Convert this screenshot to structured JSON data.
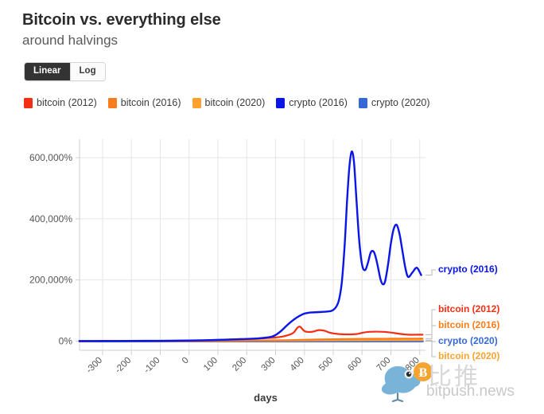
{
  "header": {
    "title": "Bitcoin vs. everything else",
    "subtitle": "around halvings"
  },
  "scale_toggle": {
    "options": [
      {
        "label": "Linear",
        "active": true
      },
      {
        "label": "Log",
        "active": false
      }
    ]
  },
  "watermark": {
    "cn_text": "比推",
    "domain": "bitpush.news",
    "bird_icon": "bird-icon",
    "coin_icon": "bitcoin-coin-icon",
    "coin_symbol": "Ƀ"
  },
  "colors": {
    "bitcoin_2012": "#f42e14",
    "bitcoin_2016": "#f97c1c",
    "bitcoin_2020": "#fba22e",
    "crypto_2016": "#0a16e8",
    "crypto_2020": "#3769d6",
    "grid": "#e6e6e6",
    "axis": "#cfcfcf",
    "text": "#555555",
    "toggle_active_bg": "#333333"
  },
  "chart_data": {
    "type": "line",
    "title": "Bitcoin vs. everything else",
    "subtitle": "around halvings",
    "xlabel": "days",
    "ylabel": "",
    "scale": "linear",
    "grid": true,
    "legend_position": "top",
    "xlim": [
      -380,
      820
    ],
    "ylim": [
      -30000,
      660000
    ],
    "xticks": [
      -300,
      -200,
      -100,
      0,
      100,
      200,
      300,
      400,
      500,
      600,
      700,
      800
    ],
    "xtick_labels": [
      "-300",
      "-200",
      "-100",
      "0",
      "100",
      "200",
      "300",
      "400",
      "500",
      "600",
      "700",
      "800"
    ],
    "yticks": [
      0,
      200000,
      400000,
      600000
    ],
    "ytick_labels": [
      "0%",
      "200,000%",
      "400,000%",
      "600,000%"
    ],
    "series": [
      {
        "name": "bitcoin (2012)",
        "color": "#f42e14",
        "end_label": "bitcoin (2012)",
        "x": [
          -380,
          -300,
          -200,
          -100,
          0,
          50,
          100,
          150,
          200,
          250,
          300,
          330,
          360,
          375,
          385,
          400,
          415,
          430,
          450,
          470,
          490,
          520,
          550,
          580,
          600,
          620,
          650,
          680,
          700,
          730,
          760,
          790,
          810
        ],
        "y": [
          0,
          200,
          500,
          900,
          1500,
          2500,
          4000,
          5500,
          7000,
          9000,
          12000,
          16000,
          26000,
          43000,
          47000,
          33000,
          30000,
          31000,
          36000,
          34000,
          27000,
          23000,
          22000,
          23000,
          27000,
          30000,
          31000,
          30000,
          28000,
          24000,
          21000,
          21000,
          21000
        ]
      },
      {
        "name": "bitcoin (2016)",
        "color": "#f97c1c",
        "end_label": "bitcoin (2016)",
        "x": [
          -380,
          -300,
          -200,
          -100,
          0,
          100,
          200,
          300,
          350,
          400,
          450,
          500,
          550,
          600,
          650,
          700,
          750,
          810
        ],
        "y": [
          0,
          80,
          150,
          250,
          400,
          900,
          1500,
          2500,
          3400,
          4500,
          5400,
          6200,
          7000,
          7500,
          7800,
          8000,
          8200,
          8400
        ]
      },
      {
        "name": "bitcoin (2020)",
        "color": "#fba22e",
        "end_label": "bitcoin (2020)",
        "x": [
          -380,
          -300,
          -200,
          -100,
          0,
          100,
          200,
          300,
          400,
          500,
          600,
          700,
          810
        ],
        "y": [
          0,
          50,
          90,
          150,
          250,
          500,
          800,
          1300,
          1900,
          2300,
          2600,
          2800,
          3000
        ]
      },
      {
        "name": "crypto (2016)",
        "color": "#0a16e8",
        "end_label": "crypto (2016)",
        "x": [
          -380,
          -300,
          -200,
          -100,
          0,
          60,
          120,
          180,
          240,
          280,
          300,
          320,
          340,
          360,
          375,
          390,
          400,
          415,
          430,
          450,
          470,
          490,
          500,
          510,
          520,
          530,
          540,
          548,
          556,
          564,
          572,
          580,
          590,
          600,
          610,
          620,
          630,
          640,
          648,
          656,
          664,
          672,
          680,
          690,
          700,
          710,
          720,
          730,
          740,
          750,
          760,
          775,
          790,
          805
        ],
        "y": [
          0,
          300,
          700,
          1200,
          2000,
          3000,
          4500,
          6500,
          9000,
          13000,
          20000,
          34000,
          52000,
          68000,
          78000,
          86000,
          90000,
          93000,
          94000,
          95000,
          96000,
          98000,
          102000,
          112000,
          135000,
          195000,
          320000,
          460000,
          570000,
          620000,
          585000,
          470000,
          330000,
          250000,
          232000,
          255000,
          290000,
          293000,
          272000,
          238000,
          202000,
          186000,
          196000,
          250000,
          320000,
          368000,
          380000,
          350000,
          295000,
          240000,
          210000,
          225000,
          240000,
          216000
        ]
      },
      {
        "name": "crypto (2020)",
        "color": "#3769d6",
        "end_label": "crypto (2020)",
        "x": [
          -380,
          -300,
          -200,
          -100,
          0,
          100,
          200,
          300,
          400,
          500,
          600,
          700,
          810
        ],
        "y": [
          0,
          0,
          0,
          0,
          0,
          0,
          0,
          0,
          0,
          0,
          0,
          0,
          0
        ]
      }
    ]
  }
}
